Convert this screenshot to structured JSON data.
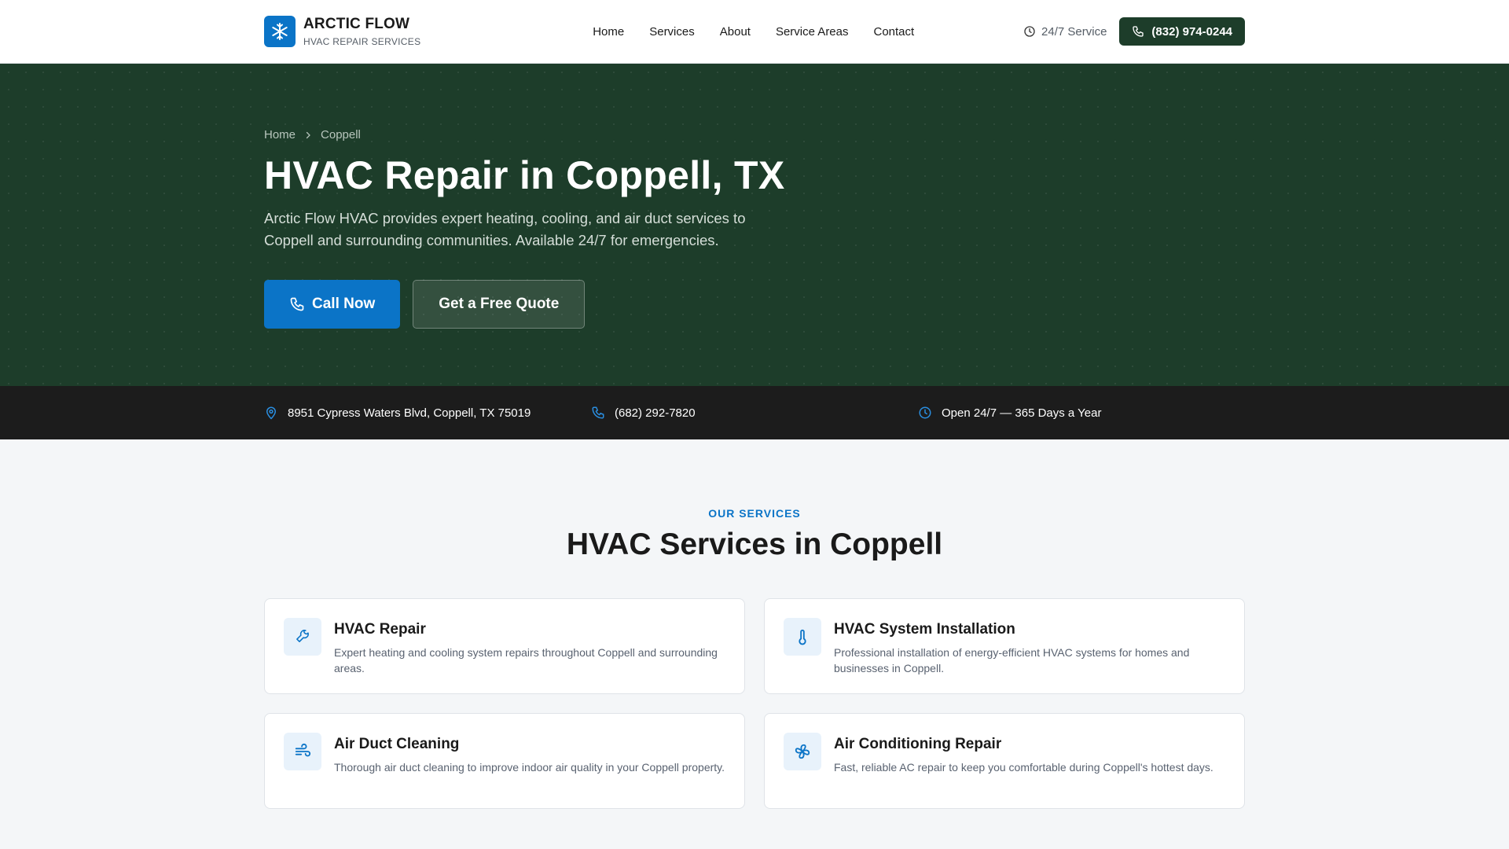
{
  "header": {
    "brand_name": "ARCTIC FLOW",
    "brand_tag": "HVAC REPAIR SERVICES",
    "nav": [
      {
        "label": "Home"
      },
      {
        "label": "Services"
      },
      {
        "label": "About"
      },
      {
        "label": "Service Areas"
      },
      {
        "label": "Contact"
      }
    ],
    "service_247": "24/7 Service",
    "phone": "(832) 974-0244"
  },
  "hero": {
    "breadcrumb": {
      "home": "Home",
      "current": "Coppell"
    },
    "title": "HVAC Repair in Coppell, TX",
    "subtitle": "Arctic Flow HVAC provides expert heating, cooling, and air duct services to Coppell and surrounding communities. Available 24/7 for emergencies.",
    "call_label": "Call Now",
    "quote_label": "Get a Free Quote"
  },
  "infobar": {
    "address": "8951 Cypress Waters Blvd, Coppell, TX 75019",
    "phone": "(682) 292-7820",
    "hours": "Open 24/7 — 365 Days a Year"
  },
  "services": {
    "eyebrow": "OUR SERVICES",
    "title": "HVAC Services in Coppell",
    "items": [
      {
        "title": "HVAC Repair",
        "desc": "Expert heating and cooling system repairs throughout Coppell and surrounding areas.",
        "icon": "wrench-icon"
      },
      {
        "title": "HVAC System Installation",
        "desc": "Professional installation of energy-efficient HVAC systems for homes and businesses in Coppell.",
        "icon": "thermometer-icon"
      },
      {
        "title": "Air Duct Cleaning",
        "desc": "Thorough air duct cleaning to improve indoor air quality in your Coppell property.",
        "icon": "wind-icon"
      },
      {
        "title": "Air Conditioning Repair",
        "desc": "Fast, reliable AC repair to keep you comfortable during Coppell's hottest days.",
        "icon": "fan-icon"
      }
    ]
  },
  "colors": {
    "accent": "#0b74c7",
    "hero_bg": "#1d3d2a",
    "infobar_bg": "#1c1c1c"
  }
}
